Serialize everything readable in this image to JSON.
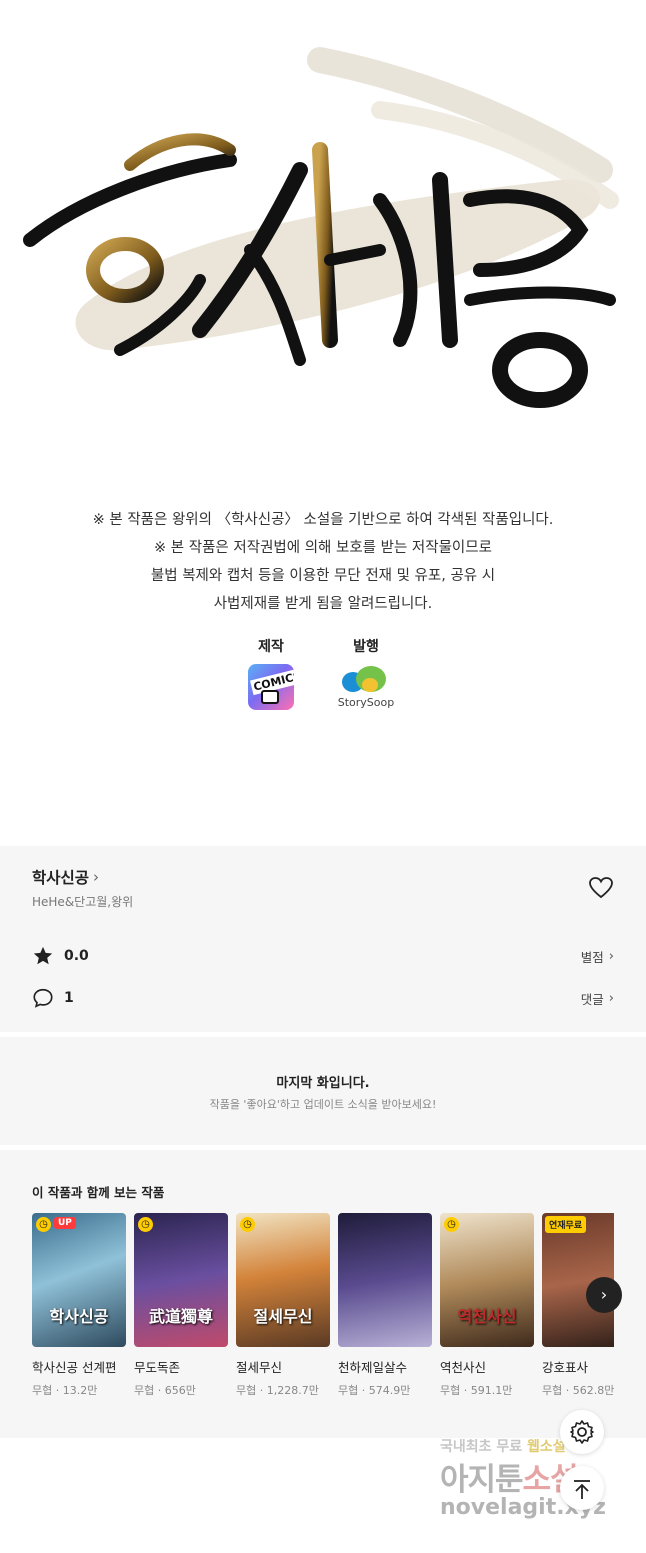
{
  "title_art": {
    "text_part1": "학사",
    "text_part2": "신공"
  },
  "notice": {
    "line1": "※ 본 작품은 왕위의 〈학사신공〉 소설을 기반으로 하여 각색된 작품입니다.",
    "line2": "※ 본 작품은 저작권법에 의해 보호를 받는 저작물이므로",
    "line3": "불법 복제와 캡처 등을 이용한 무단 전재 및 유포, 공유 시",
    "line4": "사법제재를 받게 됨을 알려드립니다."
  },
  "credits": {
    "production_label": "제작",
    "production_logo_text": "COMICS",
    "publisher_label": "발행",
    "publisher_logo_text": "StorySoop"
  },
  "work": {
    "title": "학사신공",
    "authors": "HeHe&단고월,왕위",
    "rating": "0.0",
    "rating_link": "별점",
    "comments": "1",
    "comments_link": "댓글"
  },
  "last_episode": {
    "heading": "마지막 화입니다.",
    "subtext": "작품을 '좋아요'하고 업데이트 소식을 받아보세요!"
  },
  "recommendations": {
    "heading": "이 작품과 함께 보는 작품",
    "items": [
      {
        "title": "학사신공 선계편",
        "meta": "무협 · 13.2만",
        "cover_text": "학사신공",
        "badge": "UP"
      },
      {
        "title": "무도독존",
        "meta": "무협 · 656만",
        "cover_text": "武道獨尊",
        "badge": ""
      },
      {
        "title": "절세무신",
        "meta": "무협 · 1,228.7만",
        "cover_text": "절세무신",
        "badge": ""
      },
      {
        "title": "천하제일살수",
        "meta": "무협 · 574.9만",
        "cover_text": "",
        "badge": ""
      },
      {
        "title": "역천사신",
        "meta": "무협 · 591.1만",
        "cover_text": "역천사신",
        "badge": ""
      },
      {
        "title": "강호표사",
        "meta": "무협 · 562.8만",
        "cover_text": "",
        "badge": "연재무료"
      }
    ]
  },
  "watermark": {
    "line1a": "국내최초 무료",
    "line1b": "웹소설",
    "line2a": "아지툰",
    "line2b": "소설",
    "line3": "novelagit.xyz"
  },
  "colors": {
    "panel_bg": "#f6f6f6",
    "accent_gold": "#a5802e",
    "badge_yellow": "#ffcc00",
    "badge_red": "#ff3b3b"
  }
}
